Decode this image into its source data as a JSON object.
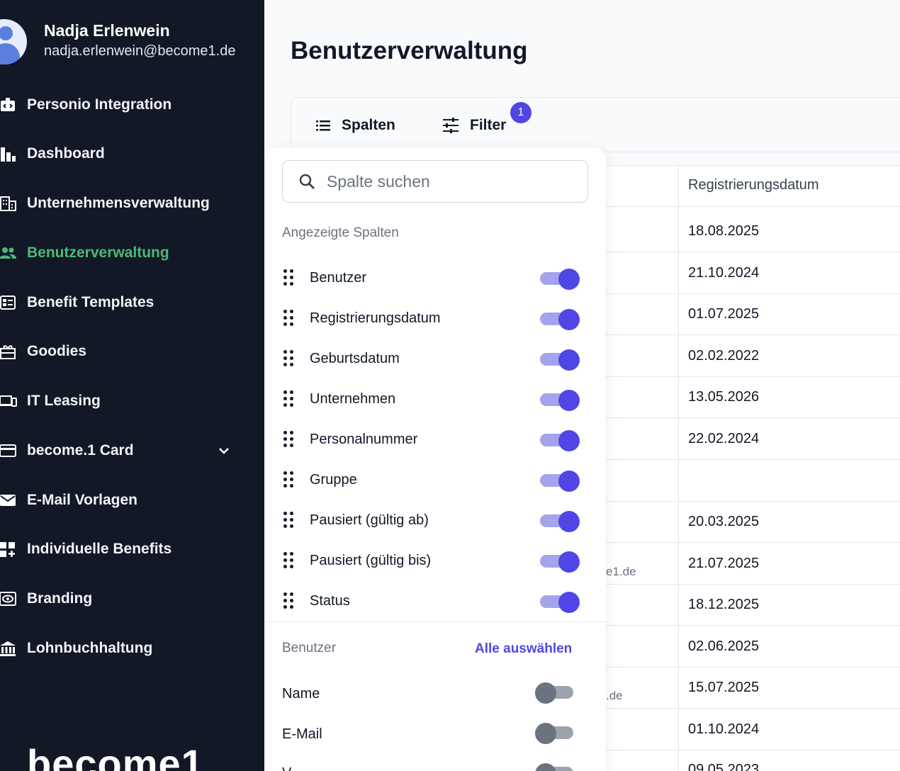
{
  "user": {
    "name": "Nadja Erlenwein",
    "email": "nadja.erlenwein@become1.de"
  },
  "sidebar": {
    "items": [
      {
        "label": "Personio Integration",
        "icon": "code-badge-icon"
      },
      {
        "label": "Dashboard",
        "icon": "bar-chart-icon"
      },
      {
        "label": "Unternehmensverwaltung",
        "icon": "building-icon"
      },
      {
        "label": "Benutzerverwaltung",
        "icon": "users-icon",
        "active": true
      },
      {
        "label": "Benefit Templates",
        "icon": "template-icon"
      },
      {
        "label": "Goodies",
        "icon": "gift-icon"
      },
      {
        "label": "IT Leasing",
        "icon": "devices-icon"
      },
      {
        "label": "become.1 Card",
        "icon": "credit-card-icon",
        "expandable": true
      },
      {
        "label": "E-Mail Vorlagen",
        "icon": "mail-icon"
      },
      {
        "label": "Individuelle Benefits",
        "icon": "widgets-add-icon"
      },
      {
        "label": "Branding",
        "icon": "eye-icon"
      },
      {
        "label": "Lohnbuchhaltung",
        "icon": "bank-icon"
      }
    ],
    "logo_text": "become1"
  },
  "page": {
    "title": "Benutzerverwaltung"
  },
  "toolbar": {
    "columns_label": "Spalten",
    "filter_label": "Filter",
    "filter_count": "1"
  },
  "table": {
    "header": "Registrierungsdatum",
    "rows": [
      {
        "date": "18.08.2025",
        "email_fragment": ""
      },
      {
        "date": "21.10.2024",
        "email_fragment": ""
      },
      {
        "date": "01.07.2025",
        "email_fragment": ""
      },
      {
        "date": "02.02.2022",
        "email_fragment": ""
      },
      {
        "date": "13.05.2026",
        "email_fragment": ""
      },
      {
        "date": "22.02.2024",
        "email_fragment": ""
      },
      {
        "date": "",
        "email_fragment": ""
      },
      {
        "date": "20.03.2025",
        "email_fragment": ""
      },
      {
        "date": "21.07.2025",
        "email_fragment": "e1.de"
      },
      {
        "date": "18.12.2025",
        "email_fragment": ""
      },
      {
        "date": "02.06.2025",
        "email_fragment": ""
      },
      {
        "date": "15.07.2025",
        "email_fragment": ".de"
      },
      {
        "date": "01.10.2024",
        "email_fragment": ""
      },
      {
        "date": "09.05.2023",
        "email_fragment": ""
      }
    ]
  },
  "popover": {
    "search_placeholder": "Spalte suchen",
    "shown_title": "Angezeigte Spalten",
    "columns": [
      {
        "label": "Benutzer",
        "on": true
      },
      {
        "label": "Registrierungsdatum",
        "on": true
      },
      {
        "label": "Geburtsdatum",
        "on": true
      },
      {
        "label": "Unternehmen",
        "on": true
      },
      {
        "label": "Personalnummer",
        "on": true
      },
      {
        "label": "Gruppe",
        "on": true
      },
      {
        "label": "Pausiert (gültig ab)",
        "on": true
      },
      {
        "label": "Pausiert (gültig bis)",
        "on": true
      },
      {
        "label": "Status",
        "on": true
      }
    ],
    "group_title": "Benutzer",
    "select_all": "Alle auswählen",
    "sub_columns": [
      {
        "label": "Name",
        "on": false
      },
      {
        "label": "E-Mail",
        "on": false
      },
      {
        "label": "V",
        "on": false
      }
    ]
  },
  "colors": {
    "sidebar_bg": "#121826",
    "active_nav": "#4fb878",
    "accent": "#4f46e5"
  }
}
